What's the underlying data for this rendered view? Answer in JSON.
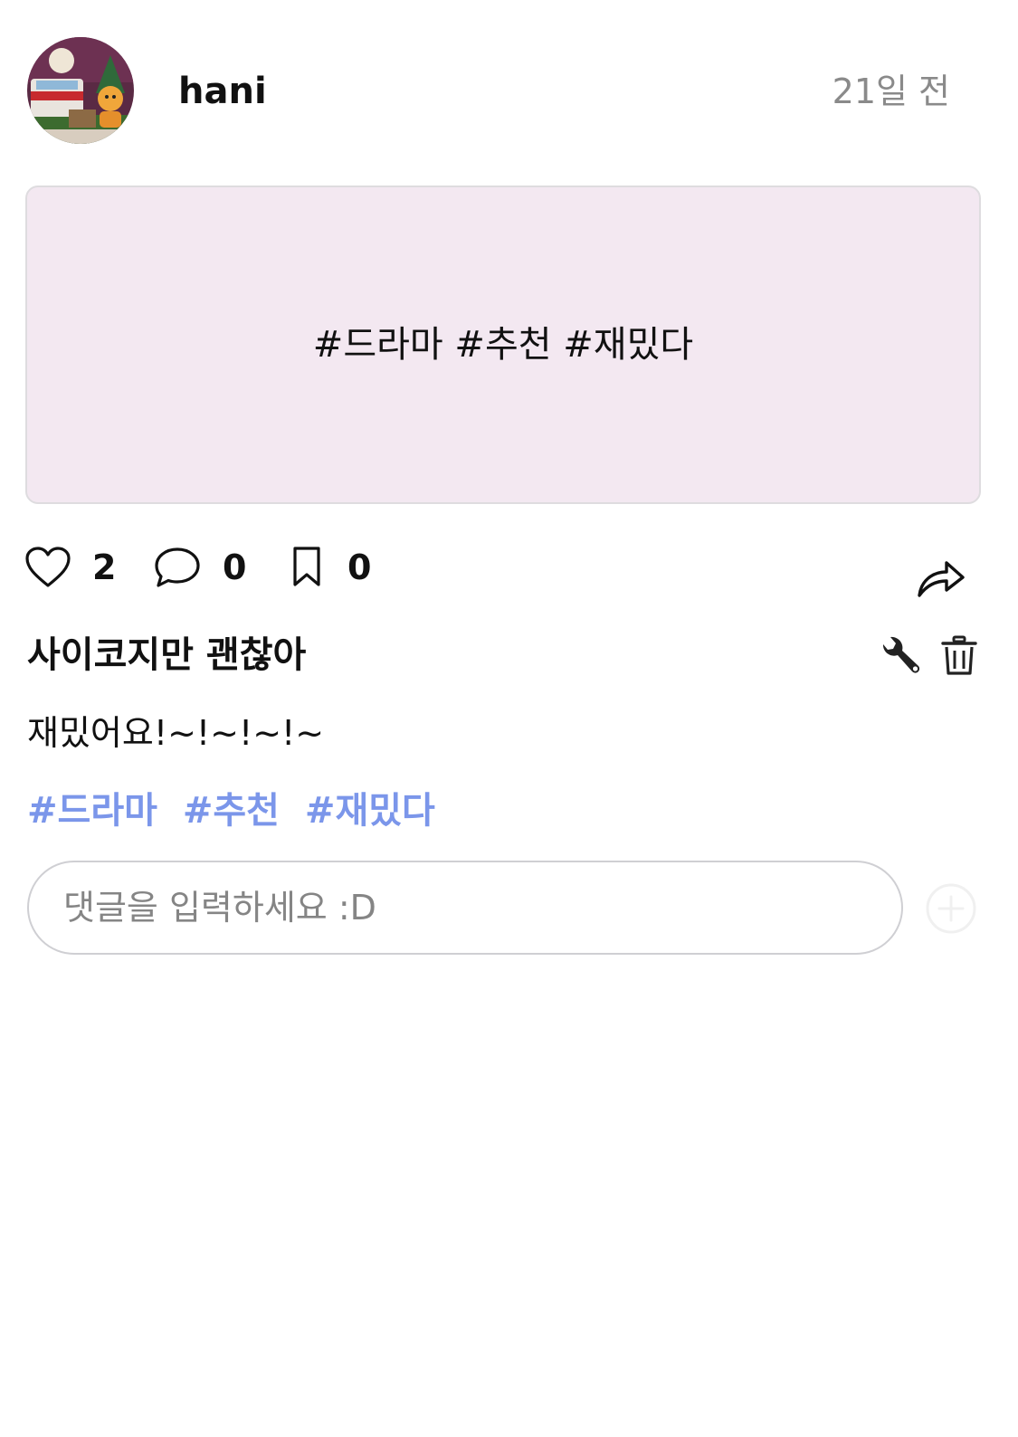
{
  "post": {
    "username": "hani",
    "timestamp": "21일 전",
    "card_text": "#드라마 #추천 #재밌다",
    "title": "사이코지만 괜찮아",
    "body": "재밌어요!~!~!~!~",
    "tags": [
      "#드라마",
      "#추천",
      "#재밌다"
    ]
  },
  "stats": {
    "likes": "2",
    "comments": "0",
    "bookmarks": "0"
  },
  "comment_box": {
    "placeholder": "댓글을 입력하세요 :D"
  },
  "colors": {
    "card_background": "#f3e8f1",
    "tag_color": "#7b96ea",
    "timestamp_color": "#8a8a8a"
  },
  "icons": {
    "like": "heart-icon",
    "comment": "speech-bubble-icon",
    "bookmark": "bookmark-icon",
    "share": "share-arrow-icon",
    "edit": "wrench-icon",
    "delete": "trash-icon",
    "add": "plus-circle-icon"
  }
}
